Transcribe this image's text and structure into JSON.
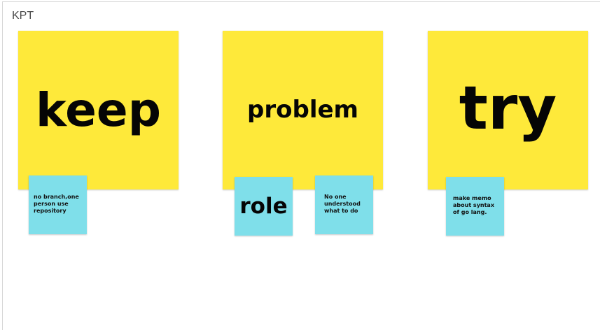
{
  "board": {
    "title": "KPT"
  },
  "big_notes": {
    "keep": "keep",
    "problem": "problem",
    "try": "try"
  },
  "small_notes": {
    "keep_note": "no branch,one person use repository",
    "role": "role",
    "problem_note": "No one understood what to do",
    "try_note": "make memo about syntax of go lang."
  },
  "colors": {
    "yellow_note": "#fee93a",
    "blue_note": "#7fdfea"
  }
}
